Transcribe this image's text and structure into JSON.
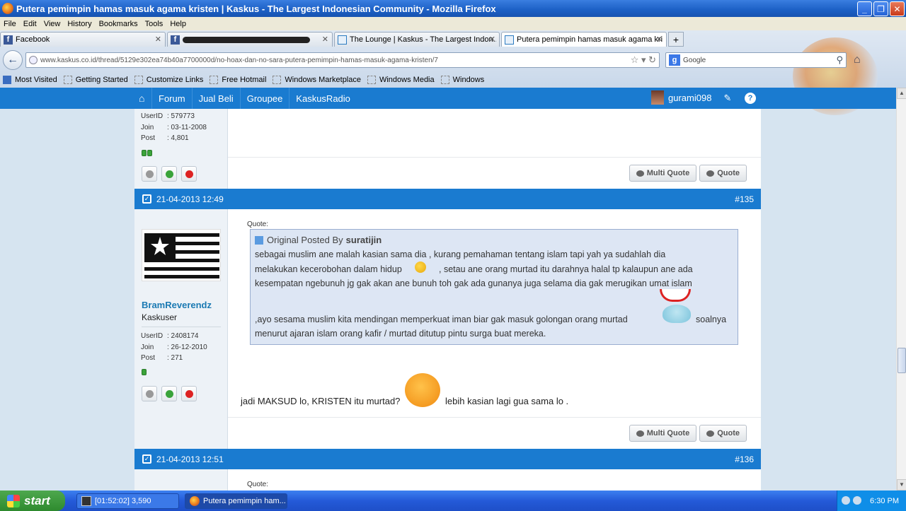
{
  "window": {
    "title": "Putera pemimpin hamas masuk agama kristen | Kaskus - The Largest Indonesian Community - Mozilla Firefox"
  },
  "menu": [
    "File",
    "Edit",
    "View",
    "History",
    "Bookmarks",
    "Tools",
    "Help"
  ],
  "tabs": [
    {
      "label": "Facebook",
      "icon": "facebook-icon"
    },
    {
      "label": "",
      "icon": "facebook-icon",
      "redacted": true
    },
    {
      "label": "The Lounge | Kaskus - The Largest Indon...",
      "icon": "kaskus-icon"
    },
    {
      "label": "Putera pemimpin hamas masuk agama kri...",
      "icon": "kaskus-icon",
      "active": true
    }
  ],
  "address": {
    "url": "www.kaskus.co.id/thread/5129e302ea74b40a7700000d/no-hoax-dan-no-sara-putera-pemimpin-hamas-masuk-agama-kristen/7"
  },
  "search": {
    "placeholder": "Google"
  },
  "bookmarks": [
    "Most Visited",
    "Getting Started",
    "Customize Links",
    "Free Hotmail",
    "Windows Marketplace",
    "Windows Media",
    "Windows"
  ],
  "kaskus_nav": {
    "items": [
      "Forum",
      "Jual Beli",
      "Groupee",
      "KaskusRadio"
    ],
    "username": "gurami098"
  },
  "post1": {
    "userid_label": "UserID",
    "userid": ": 579773",
    "join_label": "Join",
    "join": ": 03-11-2008",
    "post_label": "Post",
    "post": ": 4,801",
    "multi_quote": "Multi Quote",
    "quote": "Quote"
  },
  "post2": {
    "date": "21-04-2013 12:49",
    "number": "#135",
    "username": "BramReverendz",
    "usertitle": "Kaskuser",
    "userid_label": "UserID",
    "userid": ": 2408174",
    "join_label": "Join",
    "join": ": 26-12-2010",
    "post_label": "Post",
    "post": ": 271",
    "quote_label": "Quote:",
    "quote_header": "Original Posted By",
    "quote_author": "suratijin",
    "quote_lines": [
      "sebagai muslim ane malah kasian sama dia , kurang pemahaman tentang islam tapi yah ya sudahlah dia",
      "melakukan kecerobohan dalam hidup",
      ", setau ane orang murtad itu darahnya halal tp kalaupun ane ada",
      "kesempatan ngebunuh jg gak akan ane bunuh toh gak ada gunanya juga selama dia gak merugikan umat islam",
      ",ayo sesama muslim kita mendingan memperkuat iman biar gak masuk golongan orang murtad",
      "soalnya",
      "menurut ajaran islam orang kafir / murtad ditutup pintu surga buat mereka."
    ],
    "body_before": "jadi MAKSUD lo, KRISTEN itu murtad?",
    "body_after": "lebih kasian lagi gua sama lo .",
    "multi_quote": "Multi Quote",
    "quote": "Quote"
  },
  "post3": {
    "date": "21-04-2013 12:51",
    "number": "#136",
    "quote_label": "Quote:"
  },
  "taskbar": {
    "start": "start",
    "tasks": [
      "[01:52:02] 3,590",
      "Putera pemimpin ham..."
    ],
    "clock": "6:30 PM"
  }
}
